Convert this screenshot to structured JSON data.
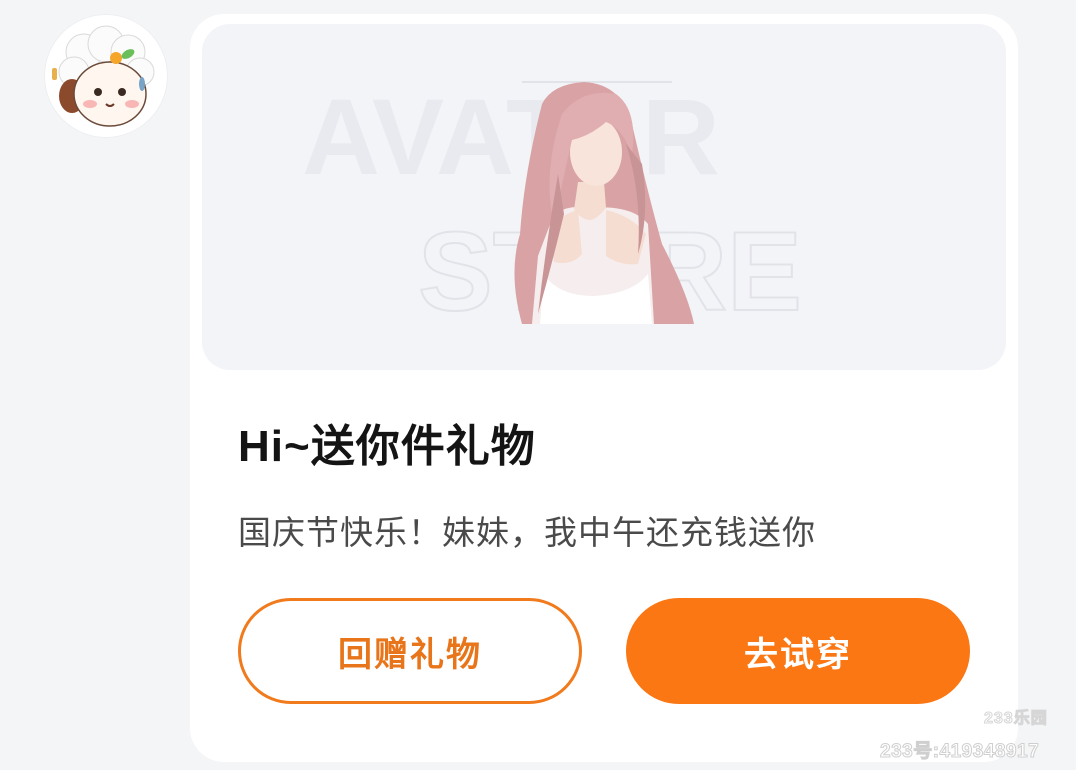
{
  "sender": {
    "avatar_icon": "sheep-avatar-icon"
  },
  "gift_card": {
    "banner": {
      "watermark_line1": "AVATAR",
      "watermark_line2": "STORE",
      "illustration": "pink-haired-avatar-figure"
    },
    "title": "Hi~送你件礼物",
    "message": "国庆节快乐！妹妹，我中午还充钱送你",
    "buttons": {
      "return_gift": "回赠礼物",
      "try_on": "去试穿"
    }
  },
  "watermark": {
    "logo": "233乐园",
    "id_text": "233号:419348917"
  },
  "colors": {
    "accent": "#fa7714",
    "outline": "#f07a1c",
    "title": "#141414",
    "text": "#4a4a4a",
    "banner_bg": "#f3f4f8",
    "page_bg": "#f4f5f7"
  }
}
